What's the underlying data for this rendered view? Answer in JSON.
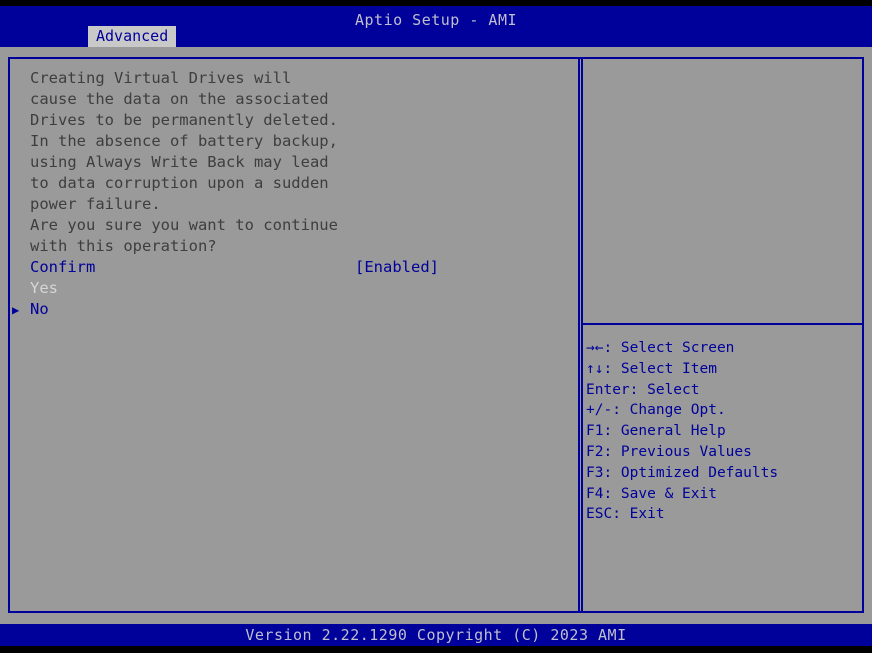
{
  "header": {
    "title": "Aptio Setup - AMI",
    "tab": "Advanced"
  },
  "left_panel": {
    "description_lines": [
      "Creating Virtual Drives will",
      "cause the data on the associated",
      "Drives to be permanently deleted.",
      "In the absence of battery backup,",
      "using Always Write Back may lead",
      "to data corruption upon a sudden",
      "power failure.",
      "Are you sure you want to continue",
      "with this operation?"
    ],
    "option": {
      "label": "Confirm",
      "value": "[Enabled]"
    },
    "choices": [
      {
        "label": "Yes",
        "selected": false
      },
      {
        "label": "No",
        "selected": true
      }
    ]
  },
  "help_panel": {
    "items": [
      "→←: Select Screen",
      "↑↓: Select Item",
      "Enter: Select",
      "+/-: Change Opt.",
      "F1: General Help",
      "F2: Previous Values",
      "F3: Optimized Defaults",
      "F4: Save & Exit",
      "ESC: Exit"
    ]
  },
  "footer": {
    "version_text": "Version 2.22.1290 Copyright (C) 2023 AMI"
  },
  "icons": {
    "pointer": "▶"
  },
  "colors": {
    "navy": "#00009B",
    "page_gray": "#9A9A9A",
    "tab_bg": "#C9C9C9",
    "band_text": "#BFBFCE",
    "text_dark": "#3E3E3E",
    "text_light": "#D6D6D6",
    "black_border": "#000000"
  }
}
